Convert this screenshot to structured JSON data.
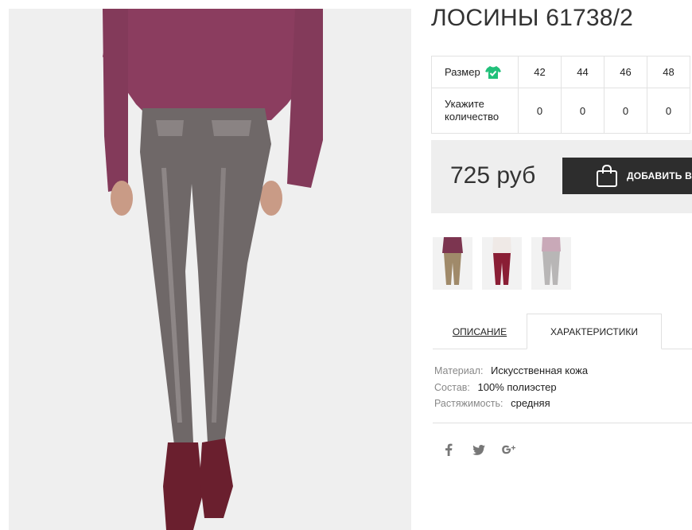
{
  "product": {
    "title": "ЛОСИНЫ 61738/2",
    "image_alt": "product-photo-grey-leather-leggings"
  },
  "sizes": {
    "size_label": "Размер",
    "size_icon": "tshirt-check-icon",
    "qty_label": "Укажите количество",
    "options": [
      {
        "size": "42",
        "qty": "0"
      },
      {
        "size": "44",
        "qty": "0"
      },
      {
        "size": "46",
        "qty": "0"
      },
      {
        "size": "48",
        "qty": "0"
      }
    ]
  },
  "purchase": {
    "price": "725 руб",
    "add_button_label": "ДОБАВИТЬ В"
  },
  "tabs": {
    "description": "ОПИСАНИЕ",
    "characteristics": "ХАРАКТЕРИСТИКИ"
  },
  "characteristics": [
    {
      "key": "Материал:",
      "value": "Искусственная кожа"
    },
    {
      "key": "Состав:",
      "value": "100% полиэстер"
    },
    {
      "key": "Растяжимость:",
      "value": "средняя"
    }
  ],
  "social": [
    "facebook-icon",
    "twitter-icon",
    "google-plus-icon"
  ],
  "colors": {
    "accent_green": "#21c07a",
    "button_dark": "#2d2d2d",
    "panel_grey": "#eeeeee"
  }
}
